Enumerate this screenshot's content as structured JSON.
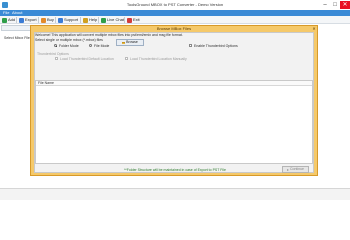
{
  "window": {
    "title": "ToolsGround MBOX to PST Converter - Demo Version",
    "controls": {
      "minimize": "–",
      "maximize": "□",
      "close": "✕"
    }
  },
  "menubar": {
    "items": [
      "File",
      "About"
    ]
  },
  "toolbar": {
    "items": [
      {
        "label": "Add",
        "icon": "add-icon",
        "color": "#2e9e4a"
      },
      {
        "label": "Export",
        "icon": "export-icon",
        "color": "#3a7bd5"
      },
      {
        "label": "Buy",
        "icon": "cart-icon",
        "color": "#e28a2b"
      },
      {
        "label": "Support",
        "icon": "support-icon",
        "color": "#3a7bd5"
      },
      {
        "label": "Help",
        "icon": "help-icon",
        "color": "#d0a020"
      },
      {
        "label": "Live Chat",
        "icon": "chat-icon",
        "color": "#2e9e4a"
      },
      {
        "label": "Exit",
        "icon": "exit-icon",
        "color": "#d23b3b"
      }
    ]
  },
  "tree": {
    "tab_label": "Select Mbox Files"
  },
  "dialog": {
    "title": "Browse MBox Files",
    "welcome": "Welcome! This application will convert multiple mbox files into pst/eml/emlx and msg file format.",
    "select_prompt": "Select single or multiple mbox (*.mbox) files",
    "modes": {
      "folder": "Folder Mode",
      "file": "File Mode"
    },
    "browse": "Browse",
    "enable_thunderbird": "Enable Thunderbird Options",
    "thunderbird_options": {
      "group_label": "Thunderbird Options",
      "default_location": "Load Thunderbird Default Location",
      "manual_location": "Load Thunderbird Location Manually"
    },
    "file_list_header": "File Name",
    "note": "**Folder Structure will be maintained in case of Export to PST File",
    "continue": "Continue"
  },
  "colors": {
    "menubar": "#3a8ad6",
    "dialog_frame": "#f5c96a",
    "note_text": "#2a7a2a"
  }
}
